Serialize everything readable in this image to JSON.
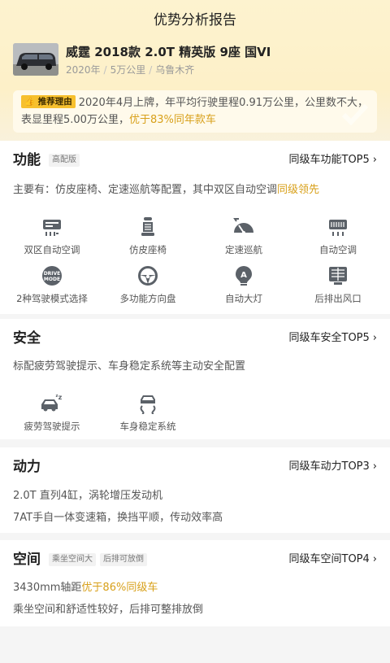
{
  "page": {
    "title": "优势分析报告"
  },
  "car": {
    "name": "威霆 2018款 2.0T 精英版 9座 国VI",
    "year": "2020年",
    "mileage": "5万公里",
    "city": "乌鲁木齐"
  },
  "reason": {
    "tag": "推荐理由",
    "text": "2020年4月上牌，年平均行驶里程0.91万公里，公里数不大，表显里程5.00万公里，",
    "highlight": "优于83%同年款车"
  },
  "sections": {
    "function": {
      "title": "功能",
      "tag": "高配版",
      "link": "同级车功能TOP5",
      "summary_prefix": "主要有：仿皮座椅、定速巡航等配置，其中双区自动空调",
      "summary_highlight": "同级领先",
      "features": [
        {
          "label": "双区自动空调",
          "icon": "dual-zone-ac-icon"
        },
        {
          "label": "仿皮座椅",
          "icon": "leather-seat-icon"
        },
        {
          "label": "定速巡航",
          "icon": "cruise-control-icon"
        },
        {
          "label": "自动空调",
          "icon": "auto-ac-icon"
        },
        {
          "label": "2种驾驶模式选择",
          "icon": "drive-mode-icon",
          "icon_text_1": "DRIVE",
          "icon_text_2": "MODE"
        },
        {
          "label": "多功能方向盘",
          "icon": "steering-wheel-icon"
        },
        {
          "label": "自动大灯",
          "icon": "auto-headlight-icon",
          "icon_text": "A"
        },
        {
          "label": "后排出风口",
          "icon": "rear-vent-icon"
        }
      ]
    },
    "safety": {
      "title": "安全",
      "link": "同级车安全TOP5",
      "summary": "标配疲劳驾驶提示、车身稳定系统等主动安全配置",
      "features": [
        {
          "label": "疲劳驾驶提示",
          "icon": "fatigue-alert-icon"
        },
        {
          "label": "车身稳定系统",
          "icon": "stability-control-icon"
        }
      ]
    },
    "power": {
      "title": "动力",
      "link": "同级车动力TOP3",
      "line1": "2.0T 直列4缸，涡轮增压发动机",
      "line2": "7AT手自一体变速箱，换挡平顺，传动效率高"
    },
    "space": {
      "title": "空间",
      "tags": [
        "乘坐空间大",
        "后排可放倒"
      ],
      "link": "同级车空间TOP4",
      "line1_prefix": "3430mm轴距",
      "line1_highlight": "优于86%同级车",
      "line2": "乘坐空间和舒适性较好，后排可整排放倒"
    }
  },
  "colors": {
    "accent": "#d8a01a",
    "tag_yellow": "#f7c02e",
    "hero_bg": "#fdf1c9",
    "text_primary": "#222222",
    "text_secondary": "#555555"
  }
}
